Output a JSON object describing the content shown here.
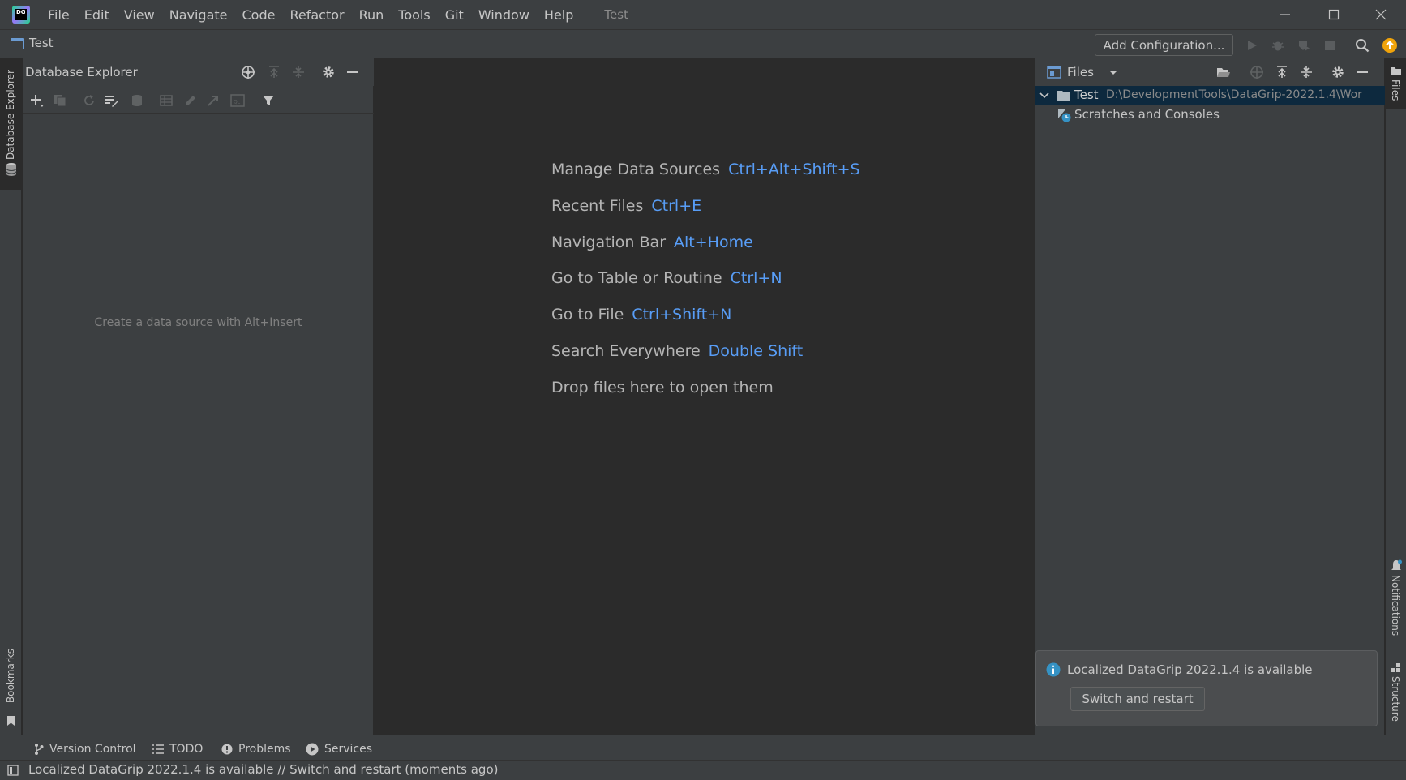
{
  "window": {
    "title": "Test",
    "menu": [
      "File",
      "Edit",
      "View",
      "Navigate",
      "Code",
      "Refactor",
      "Run",
      "Tools",
      "Git",
      "Window",
      "Help"
    ]
  },
  "navbar": {
    "project": "Test",
    "add_configuration": "Add Configuration..."
  },
  "db_explorer": {
    "title": "Database Explorer",
    "stripe_label": "Database Explorer",
    "empty_text": "Create a data source with Alt+Insert"
  },
  "editor": {
    "hints": [
      {
        "label": "Manage Data Sources",
        "shortcut": "Ctrl+Alt+Shift+S"
      },
      {
        "label": "Recent Files",
        "shortcut": "Ctrl+E"
      },
      {
        "label": "Navigation Bar",
        "shortcut": "Alt+Home"
      },
      {
        "label": "Go to Table or Routine",
        "shortcut": "Ctrl+N"
      },
      {
        "label": "Go to File",
        "shortcut": "Ctrl+Shift+N"
      },
      {
        "label": "Search Everywhere",
        "shortcut": "Double Shift"
      },
      {
        "label": "Drop files here to open them",
        "shortcut": ""
      }
    ]
  },
  "files": {
    "title": "Files",
    "tree": [
      {
        "name": "Test",
        "path": "D:\\DevelopmentTools\\DataGrip-2022.1.4\\Wor"
      },
      {
        "name": "Scratches and Consoles",
        "path": ""
      }
    ]
  },
  "right_stripe": {
    "files": "Files",
    "notifications": "Notifications",
    "structure": "Structure"
  },
  "left_stripe": {
    "bookmarks": "Bookmarks"
  },
  "notification": {
    "message": "Localized DataGrip 2022.1.4 is available",
    "button": "Switch and restart"
  },
  "bottom_tools": [
    "Version Control",
    "TODO",
    "Problems",
    "Services"
  ],
  "status": {
    "text": "Localized DataGrip 2022.1.4 is available // Switch and restart (moments ago)"
  },
  "colors": {
    "accent_link": "#589df6",
    "panel_bg": "#3c3f41",
    "editor_bg": "#2b2b2b",
    "update_badge": "#f0a30a"
  }
}
